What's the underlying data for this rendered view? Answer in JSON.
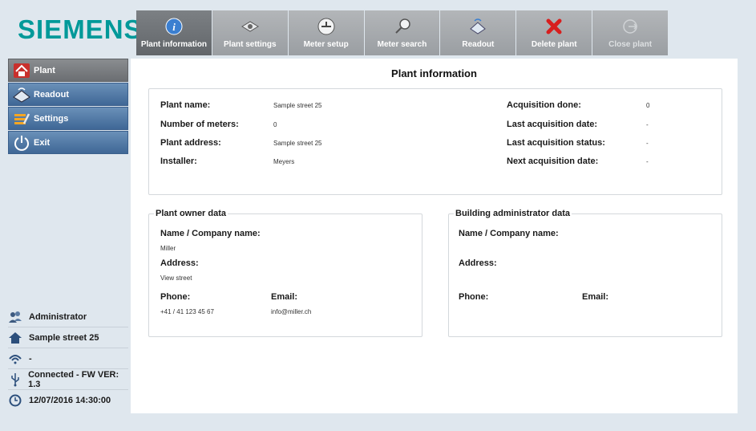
{
  "logo": "SIEMENS",
  "toolbar": [
    {
      "label": "Plant information",
      "icon": "info-icon",
      "state": "active"
    },
    {
      "label": "Plant settings",
      "icon": "eye-icon",
      "state": "normal"
    },
    {
      "label": "Meter setup",
      "icon": "meter-icon",
      "state": "normal"
    },
    {
      "label": "Meter search",
      "icon": "magnifier-icon",
      "state": "normal"
    },
    {
      "label": "Readout",
      "icon": "readout-icon",
      "state": "normal"
    },
    {
      "label": "Delete plant",
      "icon": "delete-icon",
      "state": "normal"
    },
    {
      "label": "Close plant",
      "icon": "close-plant-icon",
      "state": "disabled"
    }
  ],
  "sidebar": {
    "items": [
      {
        "label": "Plant",
        "icon": "house-icon",
        "active": true
      },
      {
        "label": "Readout",
        "icon": "readout-icon",
        "active": false
      },
      {
        "label": "Settings",
        "icon": "settings-icon",
        "active": false
      },
      {
        "label": "Exit",
        "icon": "power-icon",
        "active": false
      }
    ]
  },
  "status": {
    "user": "Administrator",
    "plant": "Sample street 25",
    "signal": "-",
    "connection": "Connected - FW VER: 1.3",
    "datetime": "12/07/2016 14:30:00"
  },
  "main": {
    "title": "Plant information",
    "info": {
      "plant_name_label": "Plant name:",
      "plant_name_value": "Sample street 25",
      "meters_label": "Number of meters:",
      "meters_value": "0",
      "address_label": "Plant address:",
      "address_value": "Sample street 25",
      "installer_label": "Installer:",
      "installer_value": "Meyers",
      "acq_done_label": "Acquisition done:",
      "acq_done_value": "0",
      "last_acq_date_label": "Last acquisition date:",
      "last_acq_date_value": "-",
      "last_acq_status_label": "Last acquisition status:",
      "last_acq_status_value": "-",
      "next_acq_date_label": "Next acquisition date:",
      "next_acq_date_value": "-"
    },
    "owner": {
      "legend": "Plant owner data",
      "name_label": "Name / Company name:",
      "name_value": "Miller",
      "address_label": "Address:",
      "address_value": "View street",
      "phone_label": "Phone:",
      "phone_value": "+41 / 41 123 45 67",
      "email_label": "Email:",
      "email_value": "info@miller.ch"
    },
    "admin": {
      "legend": "Building administrator data",
      "name_label": "Name / Company name:",
      "address_label": "Address:",
      "phone_label": "Phone:",
      "email_label": "Email:"
    }
  },
  "colors": {
    "brand": "#009999",
    "nav_blue": "#4a72a0",
    "toolbar_gray": "#a5a9ad",
    "background": "#dfe7ee"
  }
}
